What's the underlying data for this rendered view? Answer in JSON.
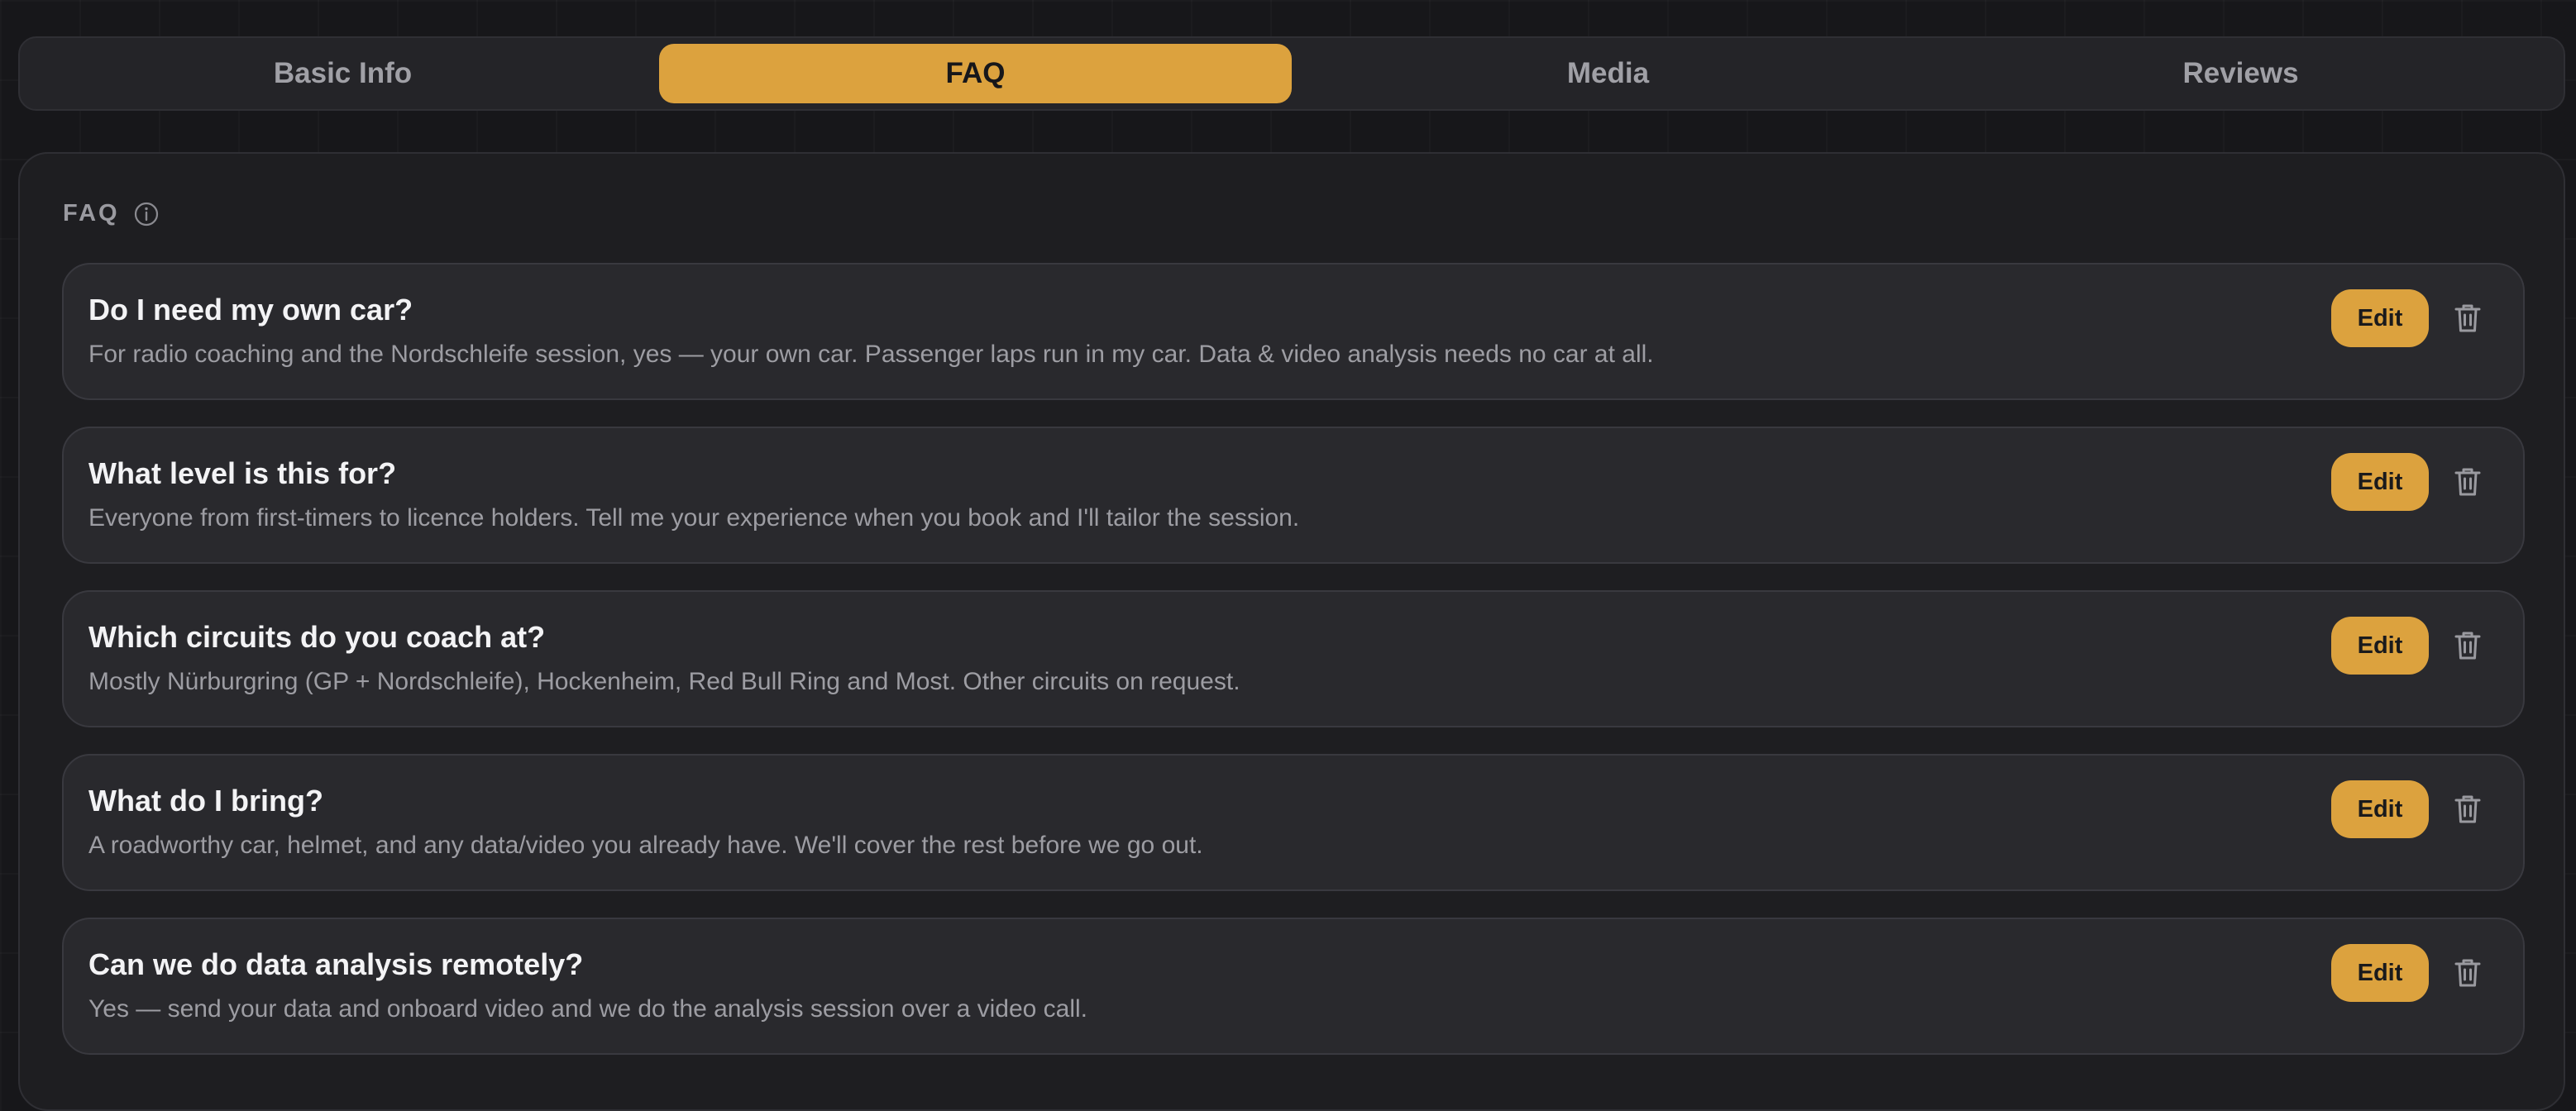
{
  "tabs": [
    {
      "label": "Basic Info",
      "active": false
    },
    {
      "label": "FAQ",
      "active": true
    },
    {
      "label": "Media",
      "active": false
    },
    {
      "label": "Reviews",
      "active": false
    }
  ],
  "section": {
    "title": "FAQ",
    "info_icon": "info-icon"
  },
  "faq": {
    "edit_label": "Edit",
    "delete_icon": "trash-icon",
    "items": [
      {
        "question": "Do I need my own car?",
        "answer": "For radio coaching and the Nordschleife session, yes — your own car. Passenger laps run in my car. Data & video analysis needs no car at all."
      },
      {
        "question": "What level is this for?",
        "answer": "Everyone from first-timers to licence holders. Tell me your experience when you book and I'll tailor the session."
      },
      {
        "question": "Which circuits do you coach at?",
        "answer": "Mostly Nürburgring (GP + Nordschleife), Hockenheim, Red Bull Ring and Most. Other circuits on request."
      },
      {
        "question": "What do I bring?",
        "answer": "A roadworthy car, helmet, and any data/video you already have. We'll cover the rest before we go out."
      },
      {
        "question": "Can we do data analysis remotely?",
        "answer": "Yes — send your data and onboard video and we do the analysis session over a video call."
      }
    ]
  },
  "colors": {
    "accent": "#dca23e",
    "background": "#17171a",
    "card": "#29292d"
  }
}
